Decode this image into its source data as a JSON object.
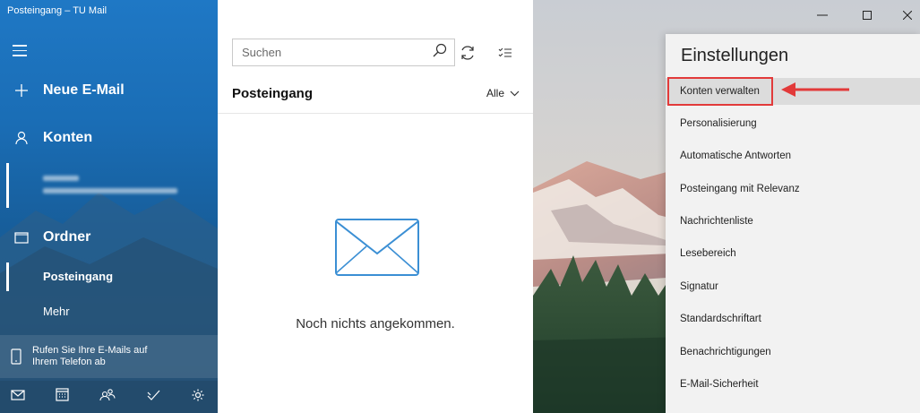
{
  "window": {
    "title": "Posteingang – TU Mail"
  },
  "sidebar": {
    "new_mail_label": "Neue E-Mail",
    "accounts_label": "Konten",
    "folders_label": "Ordner",
    "folders": [
      {
        "label": "Posteingang",
        "selected": true
      },
      {
        "label": "Mehr",
        "selected": false
      }
    ],
    "phone_promo": {
      "line1": "Rufen Sie Ihre E-Mails auf",
      "line2": "Ihrem Telefon ab"
    },
    "bottom_icons": [
      "mail-icon",
      "calendar-icon",
      "people-icon",
      "todo-icon",
      "settings-icon"
    ]
  },
  "list": {
    "search_placeholder": "Suchen",
    "header": "Posteingang",
    "filter_label": "Alle",
    "empty_message": "Noch nichts angekommen."
  },
  "settings": {
    "title": "Einstellungen",
    "items": [
      {
        "label": "Konten verwalten",
        "highlighted": true
      },
      {
        "label": "Personalisierung"
      },
      {
        "label": "Automatische Antworten"
      },
      {
        "label": "Posteingang mit Relevanz"
      },
      {
        "label": "Nachrichtenliste"
      },
      {
        "label": "Lesebereich"
      },
      {
        "label": "Signatur"
      },
      {
        "label": "Standardschriftart"
      },
      {
        "label": "Benachrichtigungen"
      },
      {
        "label": "E-Mail-Sicherheit"
      }
    ]
  },
  "colors": {
    "accent": "#1a6fb8",
    "highlight_box": "#e23a3a"
  }
}
